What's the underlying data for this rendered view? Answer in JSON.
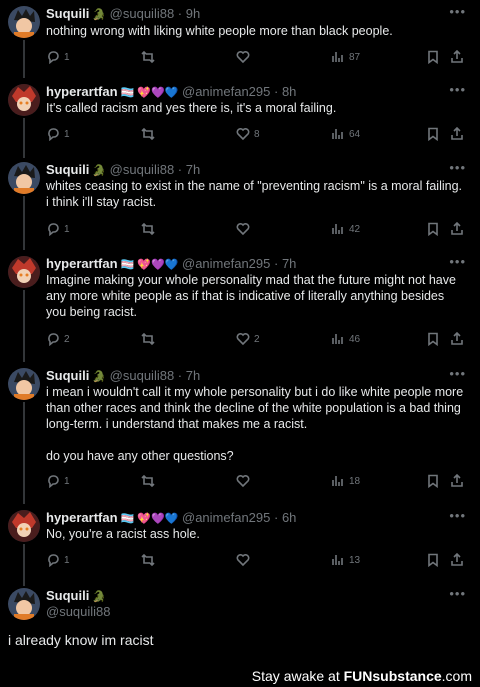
{
  "tweets": [
    {
      "name": "Suquili",
      "badges": "🐊",
      "handle": "@suquili88",
      "time": "9h",
      "text": "nothing wrong with liking white people more than black people.",
      "replies": "1",
      "retweets": "",
      "likes": "",
      "views": "87"
    },
    {
      "name": "hyperartfan",
      "badges": "🏳️‍⚧️ 💖💜💙",
      "handle": "@animefan295",
      "time": "8h",
      "text": "It's called racism and yes there is, it's a moral failing.",
      "replies": "1",
      "retweets": "",
      "likes": "8",
      "views": "64"
    },
    {
      "name": "Suquili",
      "badges": "🐊",
      "handle": "@suquili88",
      "time": "7h",
      "text": "whites ceasing to exist in the name of \"preventing racism\" is a moral failing. i think i'll stay racist.",
      "replies": "1",
      "retweets": "",
      "likes": "",
      "views": "42"
    },
    {
      "name": "hyperartfan",
      "badges": "🏳️‍⚧️ 💖💜💙",
      "handle": "@animefan295",
      "time": "7h",
      "text": "Imagine making your whole personality mad that the future might not have any more white people as if that is indicative of literally anything besides you being racist.",
      "replies": "2",
      "retweets": "",
      "likes": "2",
      "views": "46"
    },
    {
      "name": "Suquili",
      "badges": "🐊",
      "handle": "@suquili88",
      "time": "7h",
      "text": "i mean i wouldn't call it my whole personality but i do like white people more than other races and think the decline of the white population is a bad thing long-term. i understand that makes me a racist.",
      "text2": "do you have any other questions?",
      "replies": "1",
      "retweets": "",
      "likes": "",
      "views": "18"
    },
    {
      "name": "hyperartfan",
      "badges": "🏳️‍⚧️ 💖💜💙",
      "handle": "@animefan295",
      "time": "6h",
      "text": "No, you're a racist ass hole.",
      "replies": "1",
      "retweets": "",
      "likes": "",
      "views": "13"
    }
  ],
  "main_tweet": {
    "name": "Suquili",
    "badge": "🐊",
    "handle": "@suquili88",
    "text": "i already know im racist"
  },
  "watermark": {
    "prefix": "Stay awake at ",
    "brand": "FUNsubstance",
    "suffix": ".com"
  },
  "icons": {
    "reply": "reply-icon",
    "retweet": "retweet-icon",
    "like": "heart-icon",
    "views": "views-icon",
    "bookmark": "bookmark-icon",
    "share": "share-icon",
    "more": "more-icon"
  },
  "colors": {
    "bg": "#000000",
    "text": "#e7e9ea",
    "muted": "#71767b"
  }
}
